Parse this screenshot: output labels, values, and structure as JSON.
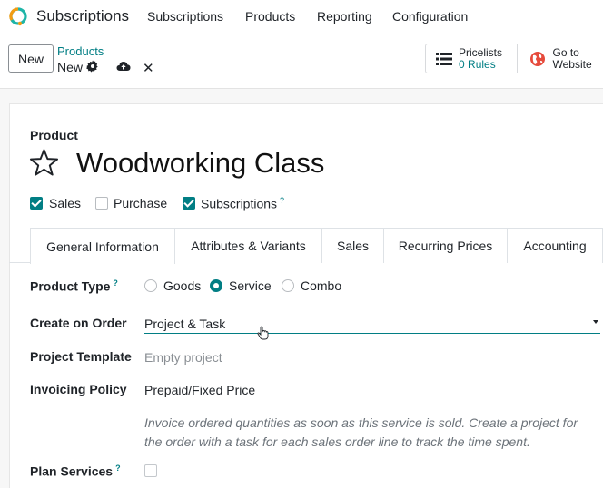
{
  "app": {
    "name": "Subscriptions"
  },
  "nav": [
    "Subscriptions",
    "Products",
    "Reporting",
    "Configuration"
  ],
  "control": {
    "new_label": "New",
    "breadcrumb_parent": "Products",
    "breadcrumb_current": "New"
  },
  "smart_buttons": {
    "pricelists": {
      "count": "0",
      "label": "Pricelists",
      "unit": "Rules"
    },
    "website": {
      "line1": "Go to",
      "line2": "Website"
    }
  },
  "form": {
    "product_label": "Product",
    "title": "Woodworking Class",
    "options": [
      {
        "label": "Sales",
        "checked": true
      },
      {
        "label": "Purchase",
        "checked": false
      },
      {
        "label": "Subscriptions",
        "checked": true,
        "help": "?"
      }
    ],
    "tabs": [
      "General Information",
      "Attributes & Variants",
      "Sales",
      "Recurring Prices",
      "Accounting"
    ],
    "active_tab": "General Information",
    "product_type": {
      "label": "Product Type",
      "help": "?",
      "choices": [
        "Goods",
        "Service",
        "Combo"
      ],
      "selected": "Service"
    },
    "create_on_order": {
      "label": "Create on Order",
      "value": "Project & Task"
    },
    "project_template": {
      "label": "Project Template",
      "placeholder": "Empty project"
    },
    "invoicing_policy": {
      "label": "Invoicing Policy",
      "value": "Prepaid/Fixed Price",
      "help_line1": "Invoice ordered quantities as soon as this service is sold. Create a project for",
      "help_line2": "the order with a task for each sales order line to track the time spent."
    },
    "plan_services": {
      "label": "Plan Services",
      "help": "?",
      "checked": false
    }
  },
  "colors": {
    "accent": "#017e84",
    "logo_orange": "#f39c12",
    "logo_teal": "#1fb5a8",
    "website_red": "#e64b3c"
  }
}
